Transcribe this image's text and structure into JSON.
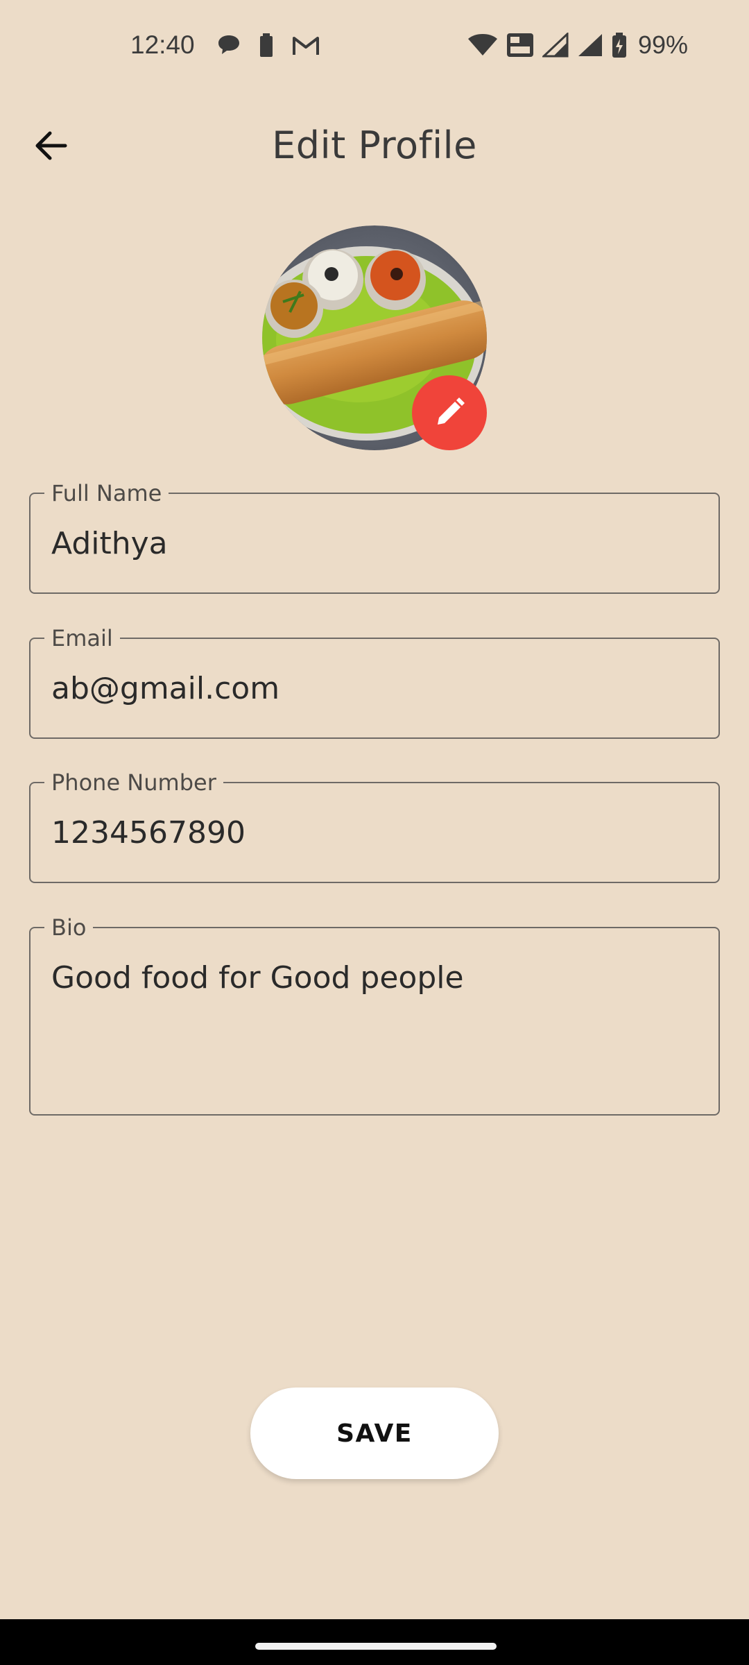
{
  "status_bar": {
    "time": "12:40",
    "battery_percent": "99%",
    "icons": [
      "chat-bubble-icon",
      "battery-small-icon",
      "gmail-icon",
      "wifi-icon",
      "volte-icon",
      "signal-icon",
      "signal-icon",
      "battery-charging-icon"
    ]
  },
  "app_bar": {
    "title": "Edit Profile",
    "back_icon": "arrow-left-icon"
  },
  "avatar": {
    "edit_icon": "pencil-icon",
    "edit_button_color": "#f0443a"
  },
  "form": {
    "full_name": {
      "label": "Full Name",
      "value": "Adithya"
    },
    "email": {
      "label": "Email",
      "value": "ab@gmail.com"
    },
    "phone": {
      "label": "Phone Number",
      "value": "1234567890"
    },
    "bio": {
      "label": "Bio",
      "value": "Good food for Good people"
    }
  },
  "actions": {
    "save_label": "SAVE"
  },
  "colors": {
    "background": "#ecdcc8",
    "accent": "#f0443a"
  }
}
